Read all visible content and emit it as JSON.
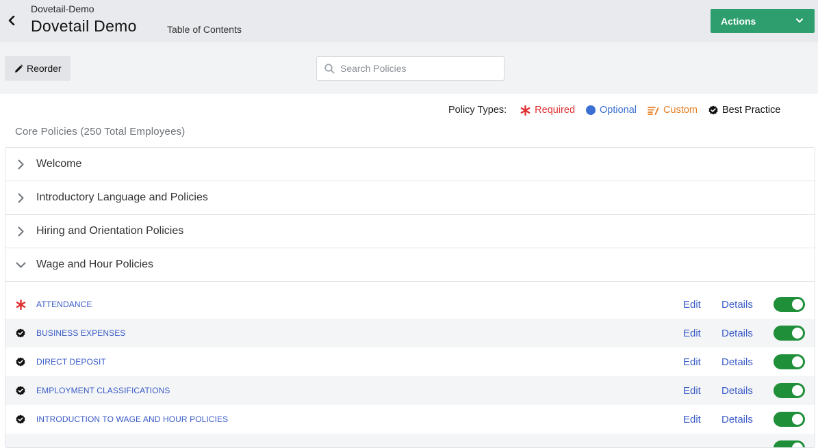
{
  "header": {
    "breadcrumb": "Dovetail-Demo",
    "title": "Dovetail Demo",
    "subtitle": "Table of Contents",
    "actions_label": "Actions"
  },
  "toolbar": {
    "reorder_label": "Reorder",
    "search_placeholder": "Search Policies",
    "search_value": ""
  },
  "legend": {
    "label": "Policy Types:",
    "items": [
      {
        "label": "Required",
        "color": "#e03131",
        "icon": "asterisk-icon"
      },
      {
        "label": "Optional",
        "color": "#3b6fd4",
        "icon": "circle-icon"
      },
      {
        "label": "Custom",
        "color": "#e67e22",
        "icon": "custom-lines-icon"
      },
      {
        "label": "Best Practice",
        "color": "#111111",
        "icon": "badge-check-icon"
      }
    ]
  },
  "section": {
    "title": "Core Policies (250 Total Employees)"
  },
  "categories": [
    {
      "label": "Welcome",
      "expanded": false
    },
    {
      "label": "Introductory Language and Policies",
      "expanded": false
    },
    {
      "label": "Hiring and Orientation Policies",
      "expanded": false
    },
    {
      "label": "Wage and Hour Policies",
      "expanded": true
    }
  ],
  "policies": [
    {
      "name": "ATTENDANCE",
      "type": "required",
      "enabled": true
    },
    {
      "name": "BUSINESS EXPENSES",
      "type": "best-practice",
      "enabled": true
    },
    {
      "name": "DIRECT DEPOSIT",
      "type": "best-practice",
      "enabled": true
    },
    {
      "name": "EMPLOYMENT CLASSIFICATIONS",
      "type": "best-practice",
      "enabled": true
    },
    {
      "name": "INTRODUCTION TO WAGE AND HOUR POLICIES",
      "type": "best-practice",
      "enabled": true
    }
  ],
  "row_actions": {
    "edit_label": "Edit",
    "details_label": "Details"
  },
  "colors": {
    "accent_green": "#2e9e6e",
    "toggle_on": "#1f8f3a",
    "link_blue": "#3a5bc7"
  }
}
